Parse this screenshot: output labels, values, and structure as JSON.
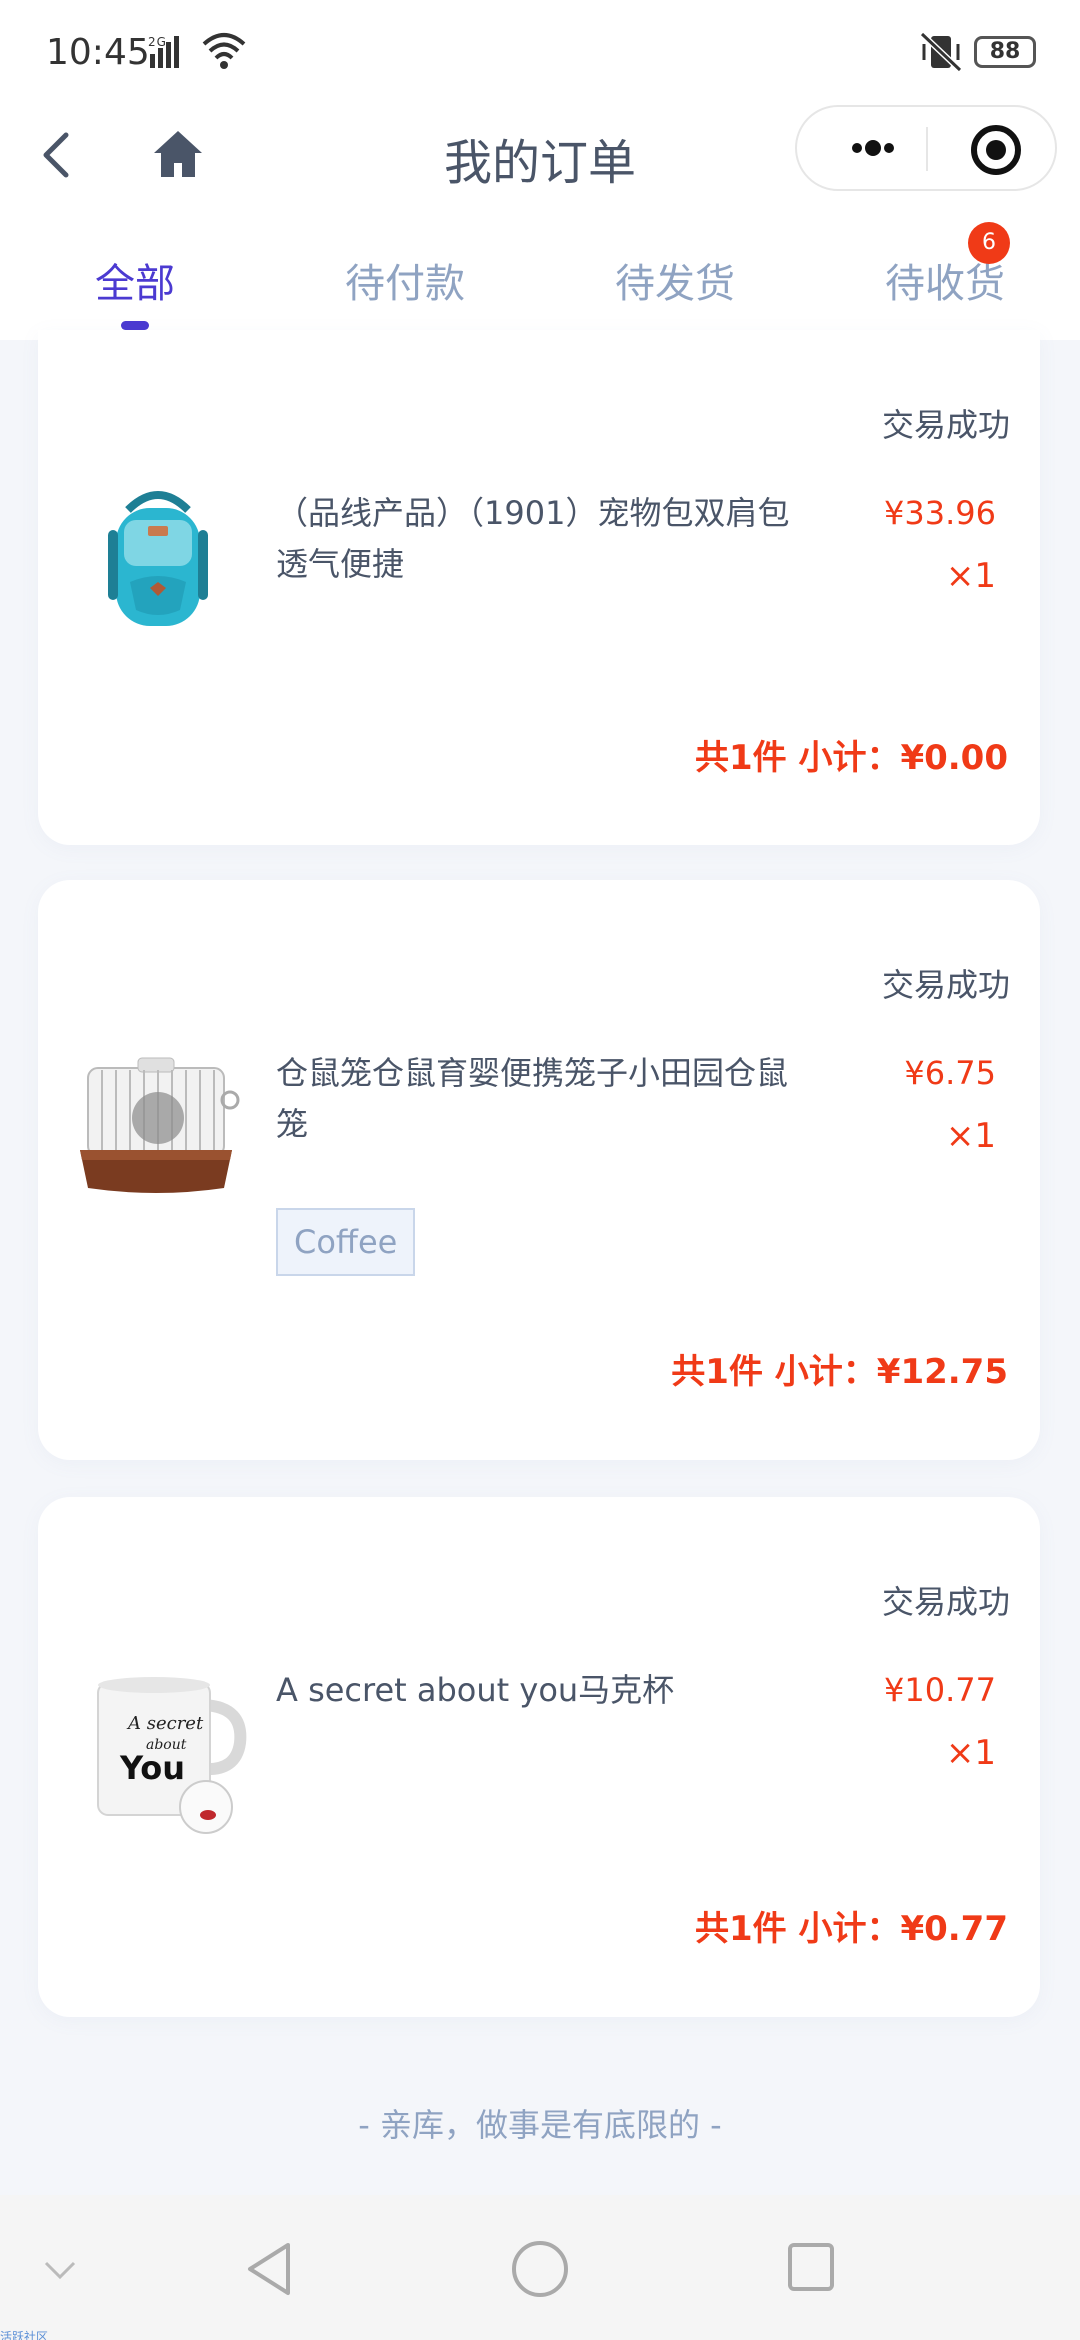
{
  "status_bar": {
    "time": "10:45",
    "signal": "2G",
    "battery": "88"
  },
  "nav": {
    "title": "我的订单"
  },
  "tabs": [
    {
      "label": "全部",
      "active": true
    },
    {
      "label": "待付款",
      "active": false
    },
    {
      "label": "待发货",
      "active": false
    },
    {
      "label": "待收货",
      "active": false,
      "badge": "6"
    }
  ],
  "orders": [
    {
      "status": "交易成功",
      "title": "（品线产品）（1901）宠物包双肩包透气便捷",
      "price": "¥33.96",
      "qty": "×1",
      "total": "共1件 小计：¥0.00",
      "image": "blue-pet-backpack"
    },
    {
      "status": "交易成功",
      "title": "仓鼠笼仓鼠育婴便携笼子小田园仓鼠笼",
      "price": "¥6.75",
      "qty": "×1",
      "spec": "Coffee",
      "total": "共1件 小计：¥12.75",
      "image": "hamster-cage"
    },
    {
      "status": "交易成功",
      "title": "A secret about you马克杯",
      "price": "¥10.77",
      "qty": "×1",
      "total": "共1件 小计：¥0.77",
      "image": "white-mug",
      "image_text": [
        "A secret",
        "about",
        "You"
      ]
    }
  ],
  "footer_note": "- 亲库，做事是有底限的 -",
  "watermark": "活跃社区",
  "colors": {
    "accent": "#4b3ad1",
    "price": "#f03a17",
    "muted": "#8fa3c2"
  }
}
